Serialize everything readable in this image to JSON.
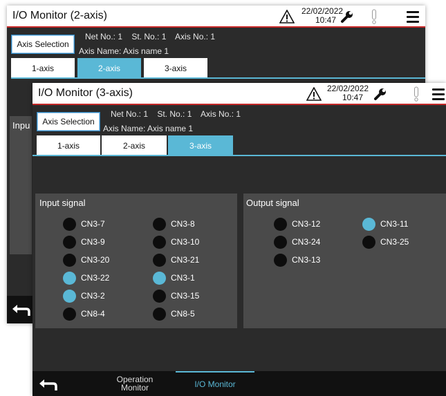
{
  "back_screen": {
    "title": "I/O Monitor (2-axis)",
    "date": "22/02/2022",
    "time": "10:47",
    "axis_selection_label": "Axis Selection",
    "net_line": "Net No.: 1    St. No.: 1    Axis No.: 1",
    "axis_name": "Axis Name: Axis name 1",
    "tabs": [
      "1-axis",
      "2-axis",
      "3-axis"
    ],
    "active_tab": 1,
    "partial_panel_label": "Inpu"
  },
  "front_screen": {
    "title": "I/O Monitor (3-axis)",
    "date": "22/02/2022",
    "time": "10:47",
    "axis_selection_label": "Axis Selection",
    "net_line": "Net No.: 1    St. No.: 1    Axis No.: 1",
    "axis_name": "Axis Name: Axis name 1",
    "tabs": [
      "1-axis",
      "2-axis",
      "3-axis"
    ],
    "active_tab": 2,
    "input_panel": {
      "title": "Input signal",
      "signals": [
        {
          "label": "CN3-7",
          "on": false
        },
        {
          "label": "CN3-8",
          "on": false
        },
        {
          "label": "CN3-9",
          "on": false
        },
        {
          "label": "CN3-10",
          "on": false
        },
        {
          "label": "CN3-20",
          "on": false
        },
        {
          "label": "CN3-21",
          "on": false
        },
        {
          "label": "CN3-22",
          "on": true
        },
        {
          "label": "CN3-1",
          "on": true
        },
        {
          "label": "CN3-2",
          "on": true
        },
        {
          "label": "CN3-15",
          "on": false
        },
        {
          "label": "CN8-4",
          "on": false
        },
        {
          "label": "CN8-5",
          "on": false
        }
      ]
    },
    "output_panel": {
      "title": "Output signal",
      "signals": [
        {
          "label": "CN3-12",
          "on": false
        },
        {
          "label": "CN3-11",
          "on": true
        },
        {
          "label": "CN3-24",
          "on": false
        },
        {
          "label": "CN3-25",
          "on": false
        },
        {
          "label": "CN3-13",
          "on": false
        }
      ]
    },
    "bottom_nav": {
      "operation_monitor_line1": "Operation",
      "operation_monitor_line2": "Monitor",
      "io_monitor": "I/O Monitor"
    }
  },
  "colors": {
    "accent": "#5ab8d6",
    "title_border": "#c62828",
    "background": "#2b2b2b",
    "panel": "#4a4a4a",
    "signal_off": "#0d0d0d"
  },
  "icons": [
    "warning-icon",
    "wrench-icon",
    "exclamation-icon",
    "menu-icon",
    "back-arrow-icon"
  ]
}
